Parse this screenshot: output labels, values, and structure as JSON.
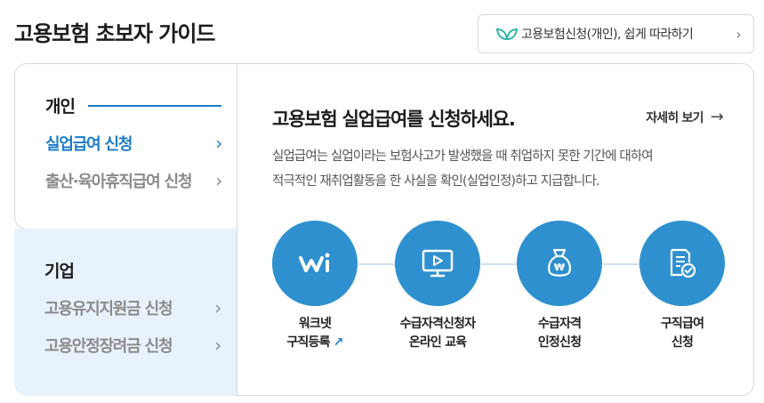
{
  "header": {
    "title": "고용보험 초보자 가이드",
    "guide_link": "고용보험신청(개인), 쉽게 따라하기",
    "guide_link_icon": "leaf-icon"
  },
  "sidebar": {
    "personal": {
      "heading": "개인",
      "items": [
        {
          "label": "실업급여 신청",
          "active": true
        },
        {
          "label": "출산·육아휴직급여 신청",
          "active": false
        }
      ]
    },
    "business": {
      "heading": "기업",
      "items": [
        {
          "label": "고용유지지원금 신청",
          "active": false
        },
        {
          "label": "고용안정장려금 신청",
          "active": false
        }
      ]
    }
  },
  "main": {
    "title": "고용보험 실업급여를 신청하세요.",
    "more_label": "자세히 보기",
    "description_line1": "실업급여는 실업이라는 보험사고가 발생했을 때 취업하지 못한 기간에 대하여",
    "description_line2": "적극적인 재취업활동을 한 사실을 확인(실업인정)하고 지급합니다.",
    "steps": [
      {
        "line1": "워크넷",
        "line2": "구직등록",
        "icon": "worknet-logo-icon",
        "external": true
      },
      {
        "line1": "수급자격신청자",
        "line2": "온라인 교육",
        "icon": "monitor-play-icon",
        "external": false
      },
      {
        "line1": "수급자격",
        "line2": "인정신청",
        "icon": "money-bag-icon",
        "external": false
      },
      {
        "line1": "구직급여",
        "line2": "신청",
        "icon": "document-check-icon",
        "external": false
      }
    ]
  },
  "colors": {
    "accent": "#1e7cc8",
    "step_circle": "#2e90cf",
    "biz_panel_bg": "#e8f2fc",
    "border": "#d4d9e2"
  }
}
